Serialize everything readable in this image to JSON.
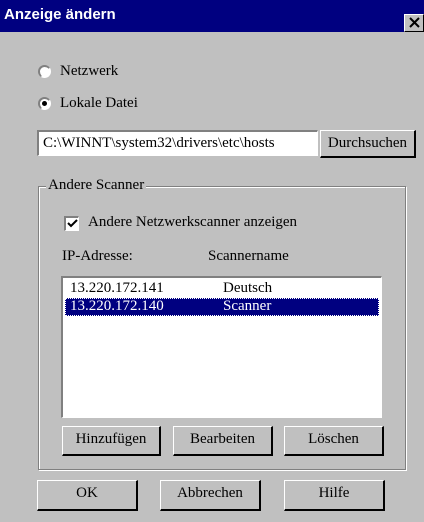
{
  "window": {
    "title": "Anzeige ändern"
  },
  "source": {
    "options": [
      {
        "label": "Netzwerk",
        "selected": false
      },
      {
        "label": "Lokale Datei",
        "selected": true
      }
    ],
    "path_value": "C:\\WINNT\\system32\\drivers\\etc\\hosts",
    "browse_label": "Durchsuchen"
  },
  "scanners": {
    "group_label": "Andere Scanner",
    "show_checkbox_label": "Andere Netzwerkscanner anzeigen",
    "show_checked": true,
    "columns": [
      "IP-Adresse:",
      "Scannername"
    ],
    "rows": [
      {
        "ip": "13.220.172.141",
        "name": "Deutsch",
        "selected": false
      },
      {
        "ip": "13.220.172.140",
        "name": "Scanner",
        "selected": true
      }
    ],
    "buttons": {
      "add": "Hinzufügen",
      "edit": "Bearbeiten",
      "delete": "Löschen"
    }
  },
  "footer": {
    "ok": "OK",
    "cancel": "Abbrechen",
    "help": "Hilfe"
  },
  "colors": {
    "titlebar": "#000080",
    "face": "#c0c0c0",
    "selection": "#000080"
  }
}
